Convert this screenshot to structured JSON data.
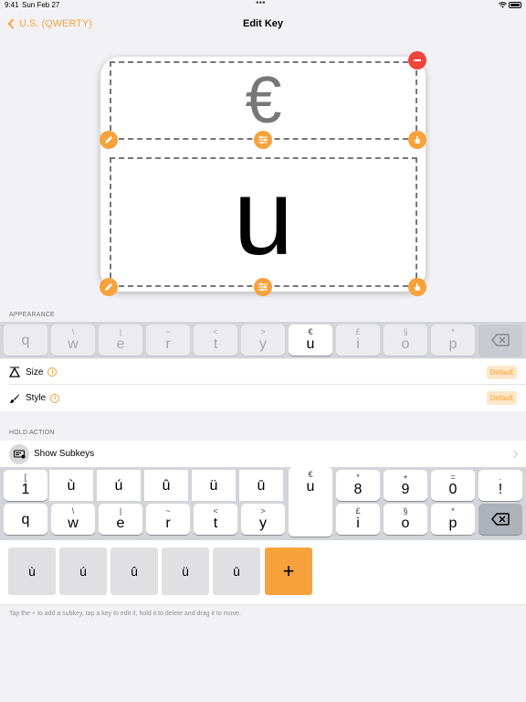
{
  "status": {
    "time": "9:41",
    "date": "Sun Feb 27",
    "dots": "•••"
  },
  "nav": {
    "back_label": "U.S. (QWERTY)",
    "title": "Edit Key"
  },
  "key_preview": {
    "top_char": "€",
    "bottom_char": "u"
  },
  "appearance": {
    "header": "APPEARANCE",
    "keys": [
      {
        "sub": "",
        "main": "q"
      },
      {
        "sub": "\\",
        "main": "w"
      },
      {
        "sub": "|",
        "main": "e"
      },
      {
        "sub": "~",
        "main": "r"
      },
      {
        "sub": "<",
        "main": "t"
      },
      {
        "sub": ">",
        "main": "y"
      },
      {
        "sub": "€",
        "main": "u"
      },
      {
        "sub": "£",
        "main": "i"
      },
      {
        "sub": "§",
        "main": "o"
      },
      {
        "sub": "*",
        "main": "p"
      }
    ],
    "size_label": "Size",
    "size_value": "Default",
    "style_label": "Style",
    "style_value": "Default"
  },
  "hold_action": {
    "header": "HOLD ACTION",
    "row_label": "Show Subkeys"
  },
  "keyboard": {
    "row1": [
      {
        "sub": "[",
        "main": "1"
      },
      {
        "sub": "",
        "main": "ù"
      },
      {
        "sub": "",
        "main": "ú"
      },
      {
        "sub": "",
        "main": "û"
      },
      {
        "sub": "",
        "main": "ü"
      },
      {
        "sub": "",
        "main": "ū"
      },
      {
        "sub": "€",
        "main": "u"
      },
      {
        "sub": "*",
        "main": "8"
      },
      {
        "sub": "+",
        "main": "9"
      },
      {
        "sub": "=",
        "main": "0"
      },
      {
        "sub": ".",
        "main": "!"
      }
    ],
    "row2": [
      {
        "sub": "",
        "main": "q"
      },
      {
        "sub": "\\",
        "main": "w"
      },
      {
        "sub": "|",
        "main": "e"
      },
      {
        "sub": "~",
        "main": "r"
      },
      {
        "sub": "<",
        "main": "t"
      },
      {
        "sub": ">",
        "main": "y"
      },
      {
        "sub": "£",
        "main": "i"
      },
      {
        "sub": "§",
        "main": "o"
      },
      {
        "sub": "*",
        "main": "p"
      }
    ]
  },
  "subkeys": [
    "ù",
    "ú",
    "û",
    "ü",
    "ū"
  ],
  "add_label": "+",
  "footnote": "Tap the + to add a subkey, tap a key to edit it, hold it to delete and drag it to move.",
  "colors": {
    "accent": "#f7a23d",
    "delete": "#f0453a",
    "background": "#f2f2f6"
  }
}
